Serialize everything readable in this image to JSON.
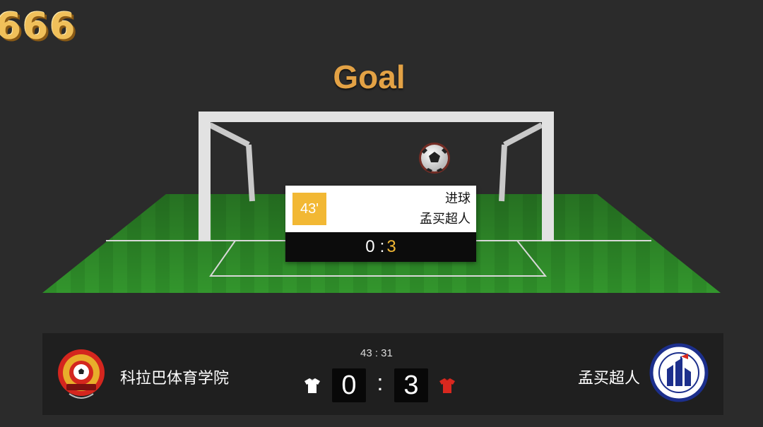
{
  "brand": {
    "logo_text": "666"
  },
  "event_banner": {
    "title": "Goal"
  },
  "event_card": {
    "minute": "43'",
    "type": "进球",
    "player": "孟买超人",
    "home_score": "0",
    "separator": ":",
    "away_score": "3"
  },
  "scoreboard": {
    "clock": "43 : 31",
    "home": {
      "name": "科拉巴体育学院",
      "score": "0",
      "shirt_color": "#ffffff",
      "crest_icon": "colaba-sports-academy-crest"
    },
    "away": {
      "name": "孟买超人",
      "score": "3",
      "shirt_color": "#d8281f",
      "crest_icon": "mumbai-ultras-fc-crest"
    },
    "separator": ":"
  },
  "colors": {
    "background": "#2b2b2b",
    "scorebar_bg": "#1f1f1f",
    "pitch_green": "#2f8f2a",
    "accent_gold": "#f2b834",
    "title_gold": "#e3a245"
  }
}
